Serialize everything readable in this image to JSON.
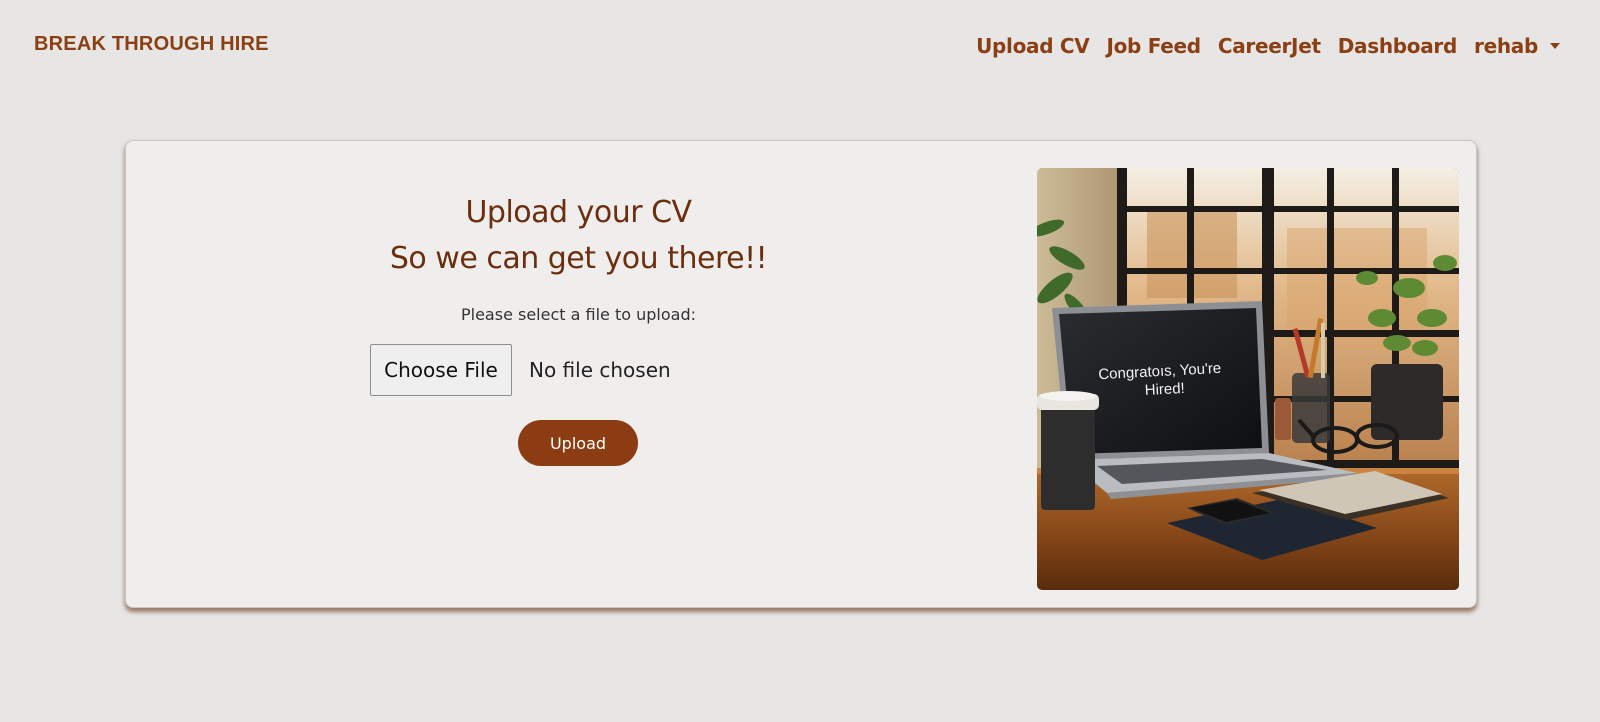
{
  "navbar": {
    "brand": "BREAK THROUGH HIRE",
    "links": [
      "Upload CV",
      "Job Feed",
      "CareerJet",
      "Dashboard"
    ],
    "user": "rehab"
  },
  "upload": {
    "title_line1": "Upload your CV",
    "title_line2": "So we can get you there!!",
    "select_label": "Please select a file to upload:",
    "choose_file_label": "Choose File",
    "no_file_text": "No file chosen",
    "upload_label": "Upload"
  },
  "photo": {
    "screen_text_line1": "Congratoıs, You're",
    "screen_text_line2": "Hired!"
  },
  "colors": {
    "brand": "#8a3f14",
    "button": "#8b3c12",
    "background": "#e8e6e4",
    "card": "#f0eeed"
  }
}
